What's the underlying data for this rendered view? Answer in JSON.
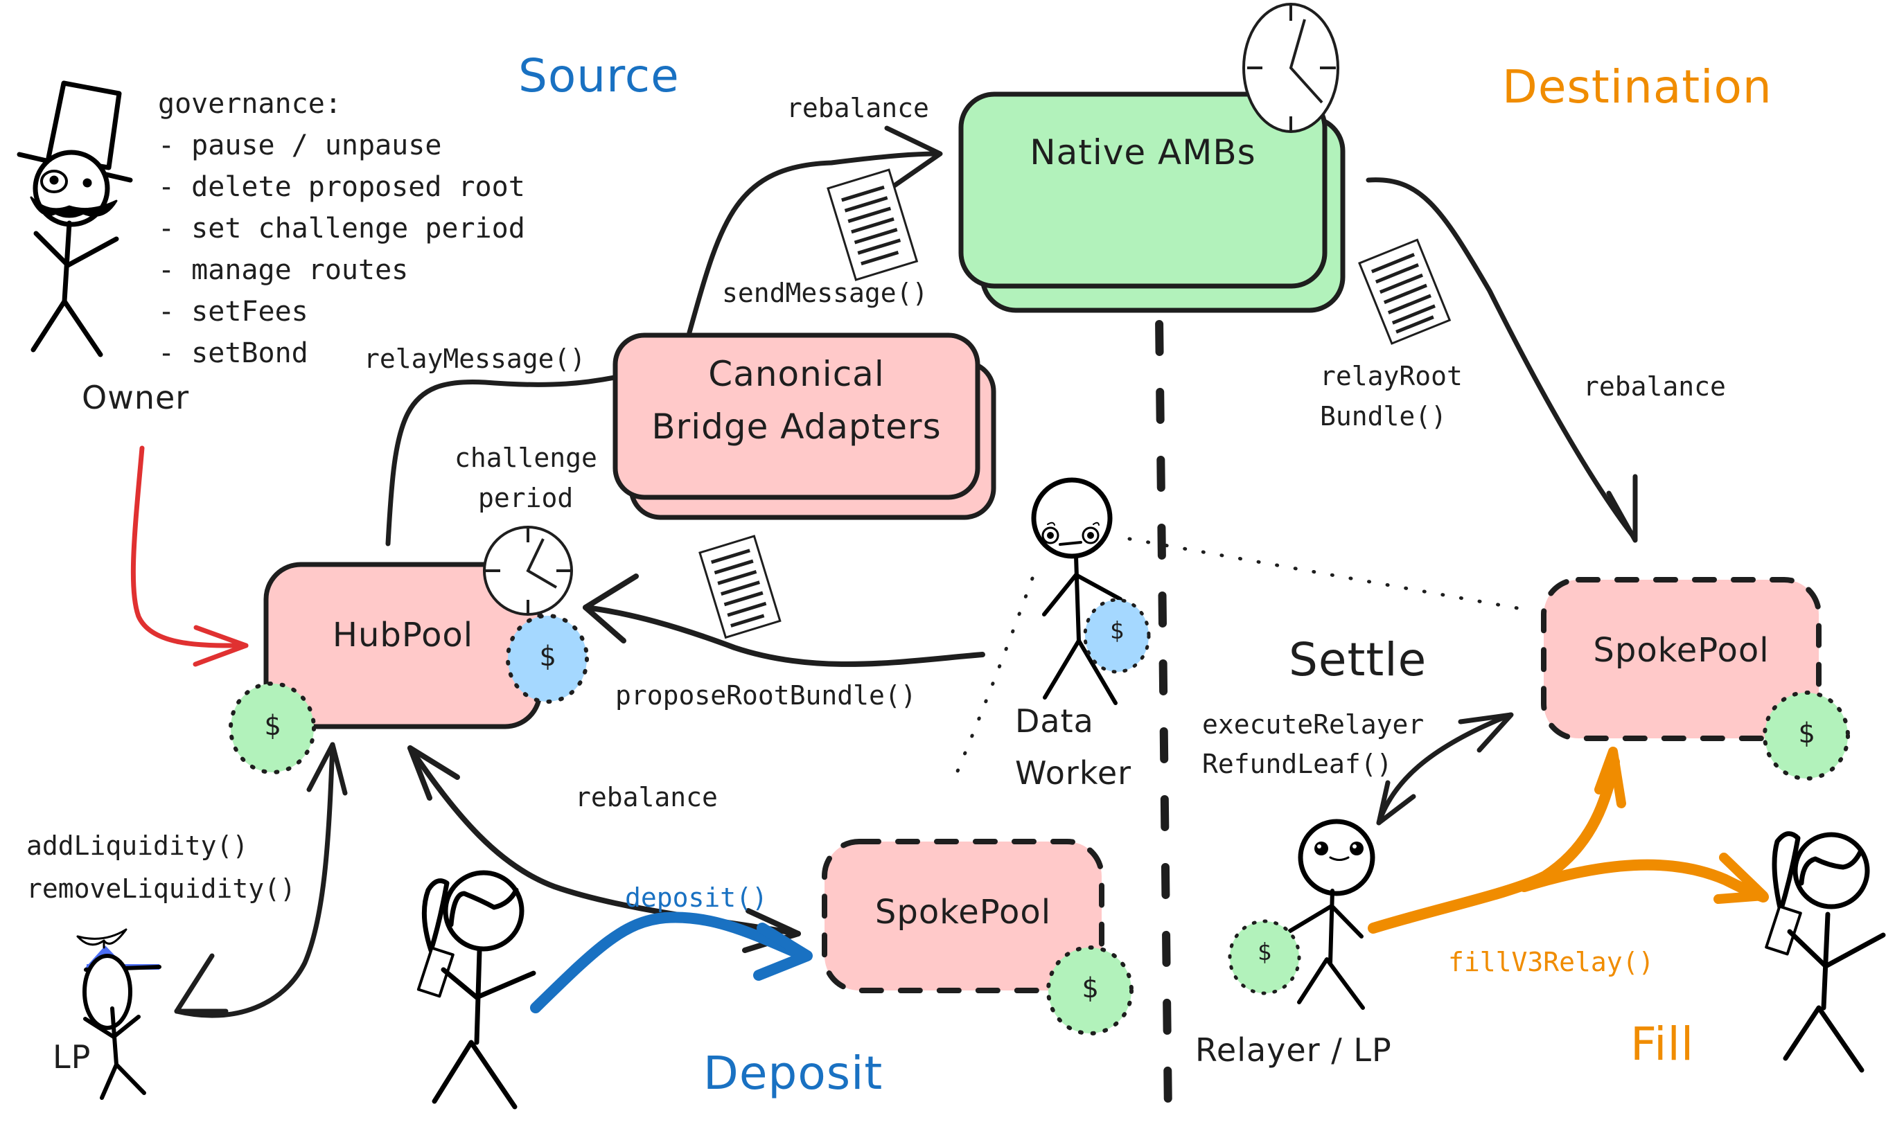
{
  "colors": {
    "ink": "#1e1e1e",
    "contract_fill": "#ffc9c9",
    "amb_fill": "#b2f2bb",
    "coin_green": "#b2f2bb",
    "coin_blue": "#a5d8ff",
    "source_blue": "#1971c2",
    "destination_orange": "#f08c00",
    "owner_red": "#e03131",
    "lp_cap_blue": "#4c6ef5"
  },
  "sections": {
    "source": "Source",
    "destination": "Destination",
    "deposit": "Deposit",
    "settle": "Settle",
    "fill": "Fill"
  },
  "governance": {
    "heading": "governance:",
    "items": [
      "- pause / unpause",
      "- delete proposed root",
      "- set challenge period",
      "- manage routes",
      "- setFees",
      "- setBond"
    ]
  },
  "actors": {
    "owner": "Owner",
    "lp": "LP",
    "data_worker": [
      "Data",
      "Worker"
    ],
    "relayer": "Relayer / LP"
  },
  "boxes": {
    "native_ambs": "Native AMBs",
    "canonical_bridge": [
      "Canonical",
      "Bridge Adapters"
    ],
    "hub_pool": "HubPool",
    "spoke_pool_source": "SpokePool",
    "spoke_pool_destination": "SpokePool"
  },
  "coin_symbol": "$",
  "edges": {
    "rebalance_top": "rebalance",
    "send_message": "sendMessage()",
    "relay_message": "relayMessage()",
    "challenge_period": [
      "challenge",
      "period"
    ],
    "propose_root_bundle": "proposeRootBundle()",
    "relay_root_bundle": [
      "relayRoot",
      "Bundle()"
    ],
    "rebalance_destination": "rebalance",
    "rebalance_hub_spoke": "rebalance",
    "add_remove_liquidity": [
      "addLiquidity()",
      "removeLiquidity()"
    ],
    "deposit": "deposit()",
    "execute_refund": [
      "executeRelayer",
      "RefundLeaf()"
    ],
    "fill_relay": "fillV3Relay()"
  },
  "icons": {
    "clock": "clock-icon",
    "document": "document-icon",
    "coin": "dollar-coin-icon"
  }
}
